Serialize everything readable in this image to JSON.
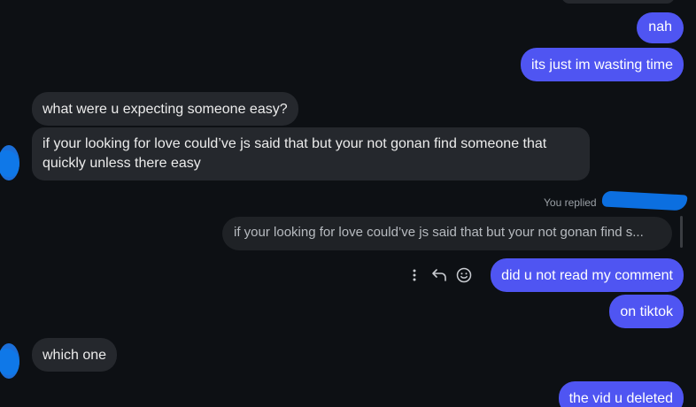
{
  "messages": {
    "nah": "nah",
    "wasting_time": "its just im wasting time",
    "expecting": "what were u expecting someone easy?",
    "looking_for_love": "if your looking for love could’ve js said that but your not gonan find someone that quickly unless there easy",
    "replied_label": "You replied",
    "quoted_reply": "if your looking for love could’ve js said that but your not gonan find s...",
    "did_u_not_read": "did u not read my comment",
    "on_tiktok": "on tiktok",
    "which_one": "which one",
    "vid_deleted": "the vid u deleted"
  },
  "icons": {
    "more": "more-options-icon",
    "reply": "reply-icon",
    "react": "emoji-react-icon"
  },
  "colors": {
    "background": "#0d1014",
    "outgoing_bubble": "#4f55f2",
    "incoming_bubble": "#25282d",
    "redaction": "#0c6fe0"
  }
}
